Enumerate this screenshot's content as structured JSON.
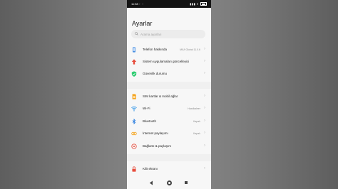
{
  "status_bar": {
    "time": "11:58",
    "notification_icons": "◦ ◦",
    "indicators": "▮▮▮ ▾"
  },
  "header": {
    "title": "Ayarlar"
  },
  "search": {
    "placeholder": "Arama ayarları"
  },
  "settings_items": [
    {
      "label": "Telefon hakkında",
      "value": "MIUI Global 11.0.6",
      "icon": "phone-info-icon",
      "color": "#4a90e2"
    },
    {
      "label": "Sistem uygulamaları güncelleyici",
      "value": "",
      "icon": "arrow-up-icon",
      "color": "#e74c3c"
    },
    {
      "label": "Güvenlik durumu",
      "value": "",
      "icon": "shield-check-icon",
      "color": "#2ecc71"
    },
    {
      "label": "SIM kartlar & mobil ağlar",
      "value": "",
      "icon": "sim-card-icon",
      "color": "#f5a623"
    },
    {
      "label": "Wi-Fi",
      "value": "Haxdkaleer",
      "icon": "wifi-icon",
      "color": "#3b9be8"
    },
    {
      "label": "Bluetooth",
      "value": "Kapalı",
      "icon": "bluetooth-icon",
      "color": "#2d7fe0"
    },
    {
      "label": "İnternet paylaşımı",
      "value": "Kapalı",
      "icon": "hotspot-icon",
      "color": "#f5a623"
    },
    {
      "label": "Bağlantı & paylaşım",
      "value": "",
      "icon": "connection-share-icon",
      "color": "#e74c3c"
    },
    {
      "label": "Kilit ekranı",
      "value": "",
      "icon": "lock-screen-icon",
      "color": "#e74c3c"
    }
  ],
  "nav_bar": {
    "back": "back-icon",
    "home": "home-icon",
    "recents": "recents-icon"
  }
}
